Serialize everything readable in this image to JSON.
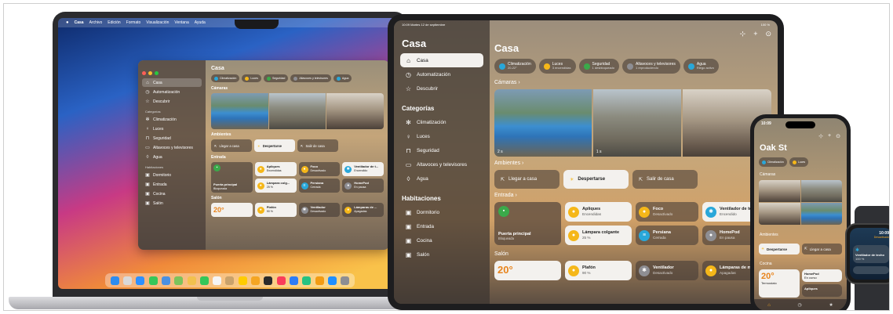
{
  "mac": {
    "menubar": [
      "Casa",
      "Archivo",
      "Edición",
      "Formato",
      "Visualización",
      "Ventana",
      "Ayuda"
    ],
    "sidebar": {
      "main": [
        {
          "label": "Casa",
          "icon": "house-icon"
        },
        {
          "label": "Automatización",
          "icon": "clock-icon"
        },
        {
          "label": "Descubrir",
          "icon": "star-icon"
        }
      ],
      "categories_head": "Categorías",
      "categories": [
        "Climatización",
        "Luces",
        "Seguridad",
        "Altavoces y televisores",
        "Agua"
      ],
      "rooms_head": "Habitaciones",
      "rooms": [
        "Dormitorio",
        "Entrada",
        "Cocina",
        "Salón"
      ]
    },
    "main": {
      "title": "Casa",
      "chips": [
        {
          "label": "Climatización",
          "sub": "20-22°"
        },
        {
          "label": "Luces",
          "sub": "3 encendidas"
        },
        {
          "label": "Seguridad",
          "sub": "1 desbloqueado"
        },
        {
          "label": "Altavoces y televisores",
          "sub": "1 reproduciendo"
        },
        {
          "label": "Agua",
          "sub": "Riego activo"
        }
      ],
      "cameras_label": "Cámaras",
      "scenes_label": "Ambientes",
      "scenes": [
        "Llegar a casa",
        "Despertarse",
        "Salir de casa"
      ],
      "entrada_label": "Entrada",
      "entrada": [
        {
          "name": "Apliques",
          "state": "Encendidas"
        },
        {
          "name": "Foco",
          "state": "Desactivado"
        },
        {
          "name": "Ventilador de t...",
          "state": "Encendido"
        },
        {
          "name": "Puerta principal",
          "state": "Bloqueada"
        },
        {
          "name": "Lámpara colg...",
          "state": "25 %"
        },
        {
          "name": "Persiana",
          "state": "Cerrada"
        },
        {
          "name": "HomePod",
          "state": "En pausa"
        }
      ],
      "salon_label": "Salón",
      "salon": [
        {
          "name": "20°",
          "state": ""
        },
        {
          "name": "Plafón",
          "state": "90 %"
        },
        {
          "name": "Ventilador",
          "state": "Desactivado"
        },
        {
          "name": "Lámparas de ...",
          "state": "Apagadas"
        }
      ]
    }
  },
  "ipad": {
    "status_time": "10:09",
    "status_date": "Martes 12 de septiembre",
    "status_right": "100 %",
    "sidebar": {
      "title": "Casa",
      "main": [
        {
          "label": "Casa",
          "icon": "house-icon"
        },
        {
          "label": "Automatización",
          "icon": "clock-icon"
        },
        {
          "label": "Descubrir",
          "icon": "star-icon"
        }
      ],
      "categories_head": "Categorías",
      "categories": [
        {
          "label": "Climatización",
          "icon": "snowflake-icon"
        },
        {
          "label": "Luces",
          "icon": "bulb-icon"
        },
        {
          "label": "Seguridad",
          "icon": "lock-icon"
        },
        {
          "label": "Altavoces y televisores",
          "icon": "tv-icon"
        },
        {
          "label": "Agua",
          "icon": "drop-icon"
        }
      ],
      "rooms_head": "Habitaciones",
      "rooms": [
        "Dormitorio",
        "Entrada",
        "Cocina",
        "Salón"
      ]
    },
    "main": {
      "title": "Casa",
      "chips": [
        {
          "label": "Climatización",
          "sub": "20-22°"
        },
        {
          "label": "Luces",
          "sub": "3 encendidas"
        },
        {
          "label": "Seguridad",
          "sub": "1 desbloqueado"
        },
        {
          "label": "Altavoces y televisores",
          "sub": "1 reproduciendo"
        },
        {
          "label": "Agua",
          "sub": "Riego activo"
        }
      ],
      "cameras_label": "Cámaras",
      "cam_badges": [
        "2 s",
        "1 s"
      ],
      "scenes_label": "Ambientes",
      "scenes": [
        "Llegar a casa",
        "Despertarse",
        "Salir de casa"
      ],
      "entrada_label": "Entrada",
      "entrada": [
        {
          "name": "Apliques",
          "state": "Encendidas"
        },
        {
          "name": "Foco",
          "state": "Desactivado"
        },
        {
          "name": "Ventilador de techo",
          "state": "Encendido"
        },
        {
          "name": "Lámpara colgante",
          "state": "25 %"
        },
        {
          "name": "Persiana",
          "state": "Cerrada"
        },
        {
          "name": "HomePod",
          "state": "En pausa"
        }
      ],
      "door": {
        "name": "Puerta principal",
        "state": "Bloqueada"
      },
      "salon_label": "Salón",
      "salon": [
        {
          "name": "20°"
        },
        {
          "name": "Plafón",
          "state": "90 %"
        },
        {
          "name": "Ventilador",
          "state": "Desactivado"
        },
        {
          "name": "Lámparas de mesa",
          "state": "Apagadas"
        }
      ]
    }
  },
  "iphone": {
    "time": "10:09",
    "title": "Oak St",
    "chips": [
      {
        "label": "Climatización",
        "sub": "20-22°"
      },
      {
        "label": "Luces",
        "sub": "3 encendidas"
      }
    ],
    "cameras_label": "Cámaras",
    "scenes_label": "Ambientes",
    "scenes": [
      "Despertarse",
      "Llegar a casa"
    ],
    "kitchen_label": "Cocina",
    "tiles": [
      {
        "name": "20°",
        "state": "Termostato"
      },
      {
        "name": "HomePod",
        "state": "En curso"
      },
      {
        "name": "Apliques",
        "state": ""
      }
    ]
  },
  "watch": {
    "time": "10:09",
    "header": "Desactivado",
    "device": "Ventilador de techo",
    "state": "100 %"
  },
  "colors": {
    "yellow": "#f5b719",
    "teal": "#29a7d9",
    "green": "#3ba94a",
    "gray": "#8e8e93"
  }
}
